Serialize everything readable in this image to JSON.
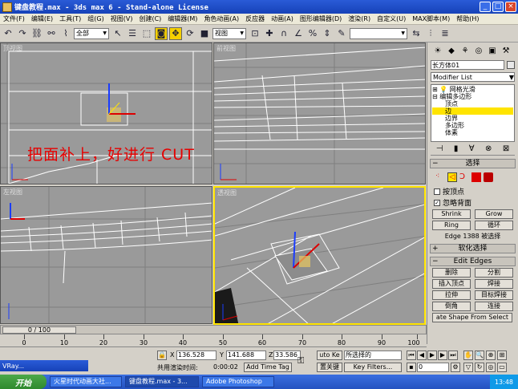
{
  "window": {
    "title": "键盘教程.max - 3ds max 6 - Stand-alone License",
    "min": "_",
    "max": "□",
    "close": "×"
  },
  "menu": [
    "文件(F)",
    "编辑(E)",
    "工具(T)",
    "组(G)",
    "视图(V)",
    "创建(C)",
    "编辑器(M)",
    "角色动画(A)",
    "反应器",
    "动画(A)",
    "图形编辑器(D)",
    "渲染(R)",
    "自定义(U)",
    "MAX脚本(M)",
    "帮助(H)"
  ],
  "toolbar": {
    "selection_filter": "全部",
    "ref_coord": "视图",
    "named_selection": ""
  },
  "viewports": {
    "top": "顶视图",
    "front": "前视图",
    "left": "左视图",
    "perspective": "透视图"
  },
  "overlay": "把面补上，好进行 CUT",
  "command_panel": {
    "object_name": "长方体01",
    "modifier_list": "Modifier List",
    "stack": [
      "网格光滑",
      "编辑多边形",
      "顶点",
      "边",
      "边界",
      "多边形",
      "体素"
    ],
    "selection_rollout": "选择",
    "by_vertex": "按顶点",
    "ignore_backfacing": "忽略背面",
    "shrink": "Shrink",
    "grow": "Grow",
    "ring": "Ring",
    "loop": "循环",
    "sel_status": "Edge 1388 被选择",
    "soft_sel": "软化选择",
    "edit_edges": "Edit Edges",
    "remove": "删除",
    "split": "分割",
    "insert_vertex": "插入顶点",
    "weld": "焊接",
    "extrude": "拉伸",
    "target_weld": "目标焊接",
    "chamfer": "倒角",
    "connect": "连接",
    "create_shape": "ate Shape From Select"
  },
  "timeline": {
    "frame": "0 / 100",
    "ticks": [
      "0",
      "10",
      "20",
      "30",
      "40",
      "50",
      "60",
      "70",
      "80",
      "90",
      "100"
    ]
  },
  "statusbar": {
    "x_label": "X",
    "x_value": "136.528",
    "y_label": "Y",
    "y_value": "141.688",
    "z_label": "Z",
    "z_value": "33.586",
    "auto_key": "uto Ke",
    "selected": "所选择的",
    "set_key": "置关键",
    "key_filters": "Key Filters...",
    "render_time_label": "共用渲染时间:",
    "render_time": "0:00:02",
    "add_time_tag": "Add Time Tag",
    "frame_field": "0"
  },
  "taskbar": {
    "start": "开始",
    "tasks": [
      "火星时代动画大社...",
      "键盘教程.max - 3...",
      "Adobe Photoshop"
    ],
    "clock": "13:48",
    "vray": "VRay..."
  },
  "colors": {
    "accent": "#ffe400",
    "overlay": "#e60000",
    "viewport_bg": "#9a9a9a"
  }
}
